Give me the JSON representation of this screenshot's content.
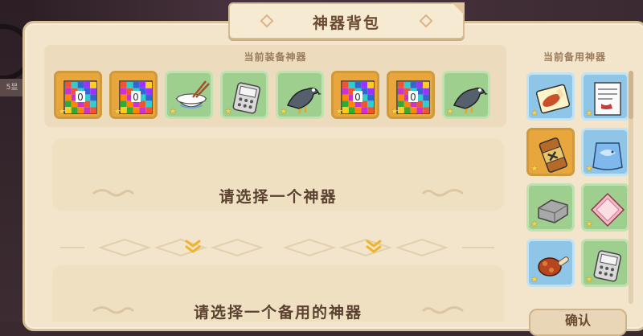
{
  "window": {
    "title": "神器背包"
  },
  "equipped": {
    "label": "当前装备神器",
    "items": [
      {
        "icon": "pixel-card-icon",
        "bg": "orange"
      },
      {
        "icon": "pixel-card-icon",
        "bg": "orange"
      },
      {
        "icon": "rice-bowl-icon",
        "bg": "green"
      },
      {
        "icon": "phone-icon",
        "bg": "green"
      },
      {
        "icon": "pigeon-icon",
        "bg": "green"
      },
      {
        "icon": "pixel-card-icon",
        "bg": "orange"
      },
      {
        "icon": "pixel-card-icon",
        "bg": "orange"
      },
      {
        "icon": "pigeon-icon",
        "bg": "green"
      }
    ]
  },
  "select_artifact": {
    "prompt": "请选择一个神器"
  },
  "select_spare": {
    "prompt": "请选择一个备用的神器"
  },
  "spare": {
    "label": "当前备用神器",
    "items": [
      {
        "icon": "meat-scroll-icon",
        "bg": "blue"
      },
      {
        "icon": "paper-note-icon",
        "bg": "blue"
      },
      {
        "icon": "bomb-canister-icon",
        "bg": "orange"
      },
      {
        "icon": "blue-fish-bag-icon",
        "bg": "blue"
      },
      {
        "icon": "stone-brick-icon",
        "bg": "green"
      },
      {
        "icon": "pink-cloth-icon",
        "bg": "green"
      },
      {
        "icon": "roast-meat-icon",
        "bg": "blue"
      },
      {
        "icon": "phone-icon",
        "bg": "green"
      }
    ]
  },
  "confirm_button": {
    "label": "确认"
  },
  "backdrop": {
    "tag": "5显"
  },
  "colors": {
    "parchment": "#f3e5cb",
    "orange_slot": "#e8a63d",
    "green_slot": "#9ecf8f",
    "blue_slot": "#8fc6e8",
    "title_text": "#6b4a32"
  }
}
